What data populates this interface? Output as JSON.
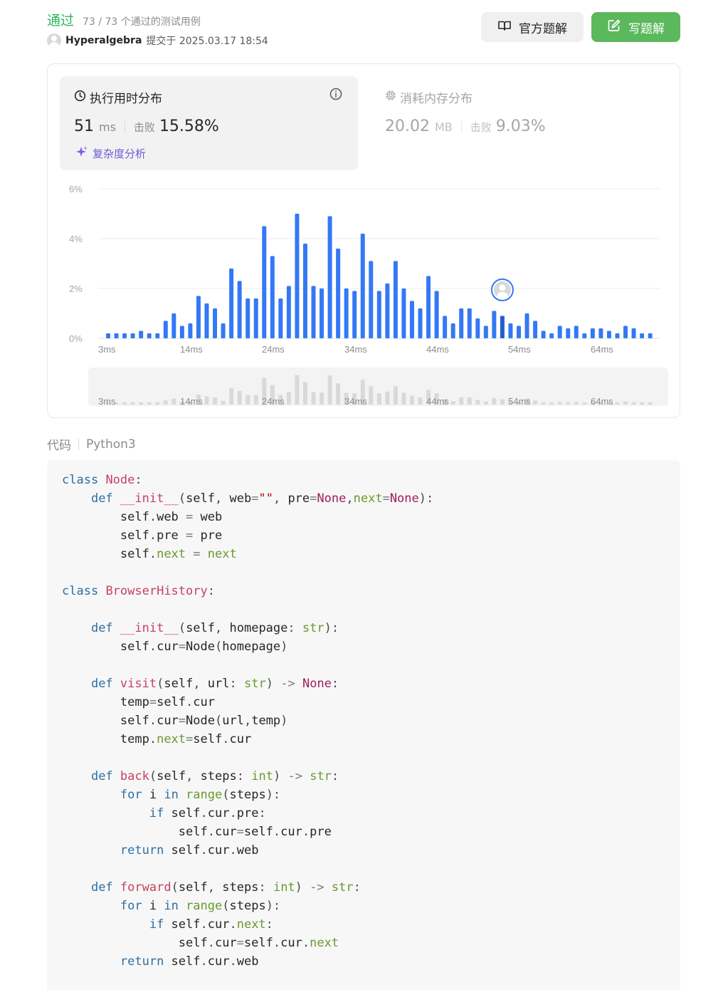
{
  "header": {
    "status": "通过",
    "testcases": "73 / 73 个通过的测试用例",
    "username": "Hyperalgebra",
    "submitted_text": "提交于 2025.03.17 18:54",
    "official_button": "官方题解",
    "write_button": "写题解"
  },
  "runtime": {
    "title": "执行用时分布",
    "value": "51",
    "unit": "ms",
    "beat_label": "击败",
    "beat_percent": "15.58%",
    "complexity_link": "复杂度分析"
  },
  "memory": {
    "title": "消耗内存分布",
    "value": "20.02",
    "unit": "MB",
    "beat_label": "击败",
    "beat_percent": "9.03%"
  },
  "chart_data": {
    "type": "bar",
    "x_tick_labels": [
      "3ms",
      "14ms",
      "24ms",
      "34ms",
      "44ms",
      "54ms",
      "64ms"
    ],
    "y_tick_labels": [
      "6%",
      "4%",
      "2%",
      "0%"
    ],
    "ylim": [
      0,
      6
    ],
    "values": [
      0.2,
      0.2,
      0.2,
      0.2,
      0.3,
      0.2,
      0.2,
      0.7,
      1.0,
      0.5,
      0.6,
      1.7,
      1.4,
      1.2,
      0.6,
      2.8,
      2.3,
      1.6,
      1.6,
      4.5,
      3.3,
      1.6,
      2.1,
      5.0,
      3.8,
      2.1,
      2.0,
      4.9,
      3.6,
      2.0,
      1.9,
      4.2,
      3.1,
      1.9,
      2.2,
      3.1,
      2.0,
      1.5,
      1.2,
      2.5,
      1.9,
      0.9,
      0.6,
      1.2,
      1.2,
      0.8,
      0.5,
      1.1,
      0.9,
      0.6,
      0.5,
      1.0,
      0.7,
      0.3,
      0.2,
      0.5,
      0.4,
      0.5,
      0.2,
      0.4,
      0.4,
      0.3,
      0.2,
      0.5,
      0.4,
      0.2,
      0.2
    ],
    "highlight_index": 48,
    "bar_color": "#3478f6",
    "highlight_color": "#1f5fd1",
    "grid": true
  },
  "code": {
    "label": "代码",
    "language": "Python3",
    "lines": [
      [
        [
          "kw",
          "class"
        ],
        [
          "t",
          " "
        ],
        [
          "cls",
          "Node"
        ],
        [
          "pun",
          ":"
        ]
      ],
      [
        [
          "t",
          "    "
        ],
        [
          "kw",
          "def"
        ],
        [
          "t",
          " "
        ],
        [
          "fn",
          "__init__"
        ],
        [
          "pun",
          "("
        ],
        [
          "t",
          "self"
        ],
        [
          "pun",
          ","
        ],
        [
          "t",
          " web"
        ],
        [
          "op",
          "="
        ],
        [
          "str",
          "\"\""
        ],
        [
          "pun",
          ","
        ],
        [
          "t",
          " pre"
        ],
        [
          "op",
          "="
        ],
        [
          "nn",
          "None"
        ],
        [
          "pun",
          ","
        ],
        [
          "bi",
          "next"
        ],
        [
          "op",
          "="
        ],
        [
          "nn",
          "None"
        ],
        [
          "pun",
          "):"
        ]
      ],
      [
        [
          "t",
          "        self"
        ],
        [
          "pun",
          "."
        ],
        [
          "t",
          "web "
        ],
        [
          "op",
          "="
        ],
        [
          "t",
          " web"
        ]
      ],
      [
        [
          "t",
          "        self"
        ],
        [
          "pun",
          "."
        ],
        [
          "t",
          "pre "
        ],
        [
          "op",
          "="
        ],
        [
          "t",
          " pre"
        ]
      ],
      [
        [
          "t",
          "        self"
        ],
        [
          "pun",
          "."
        ],
        [
          "bi",
          "next"
        ],
        [
          "t",
          " "
        ],
        [
          "op",
          "="
        ],
        [
          "t",
          " "
        ],
        [
          "bi",
          "next"
        ]
      ],
      [],
      [
        [
          "kw",
          "class"
        ],
        [
          "t",
          " "
        ],
        [
          "cls",
          "BrowserHistory"
        ],
        [
          "pun",
          ":"
        ]
      ],
      [],
      [
        [
          "t",
          "    "
        ],
        [
          "kw",
          "def"
        ],
        [
          "t",
          " "
        ],
        [
          "fn",
          "__init__"
        ],
        [
          "pun",
          "("
        ],
        [
          "t",
          "self"
        ],
        [
          "pun",
          ","
        ],
        [
          "t",
          " homepage"
        ],
        [
          "pun",
          ":"
        ],
        [
          "t",
          " "
        ],
        [
          "bi",
          "str"
        ],
        [
          "pun",
          "):"
        ]
      ],
      [
        [
          "t",
          "        self"
        ],
        [
          "pun",
          "."
        ],
        [
          "t",
          "cur"
        ],
        [
          "op",
          "="
        ],
        [
          "t",
          "Node"
        ],
        [
          "pun",
          "("
        ],
        [
          "t",
          "homepage"
        ],
        [
          "pun",
          ")"
        ]
      ],
      [],
      [
        [
          "t",
          "    "
        ],
        [
          "kw",
          "def"
        ],
        [
          "t",
          " "
        ],
        [
          "fn",
          "visit"
        ],
        [
          "pun",
          "("
        ],
        [
          "t",
          "self"
        ],
        [
          "pun",
          ","
        ],
        [
          "t",
          " url"
        ],
        [
          "pun",
          ":"
        ],
        [
          "t",
          " "
        ],
        [
          "bi",
          "str"
        ],
        [
          "pun",
          ")"
        ],
        [
          "t",
          " "
        ],
        [
          "op",
          "->"
        ],
        [
          "t",
          " "
        ],
        [
          "nn",
          "None"
        ],
        [
          "pun",
          ":"
        ]
      ],
      [
        [
          "t",
          "        temp"
        ],
        [
          "op",
          "="
        ],
        [
          "t",
          "self"
        ],
        [
          "pun",
          "."
        ],
        [
          "t",
          "cur"
        ]
      ],
      [
        [
          "t",
          "        self"
        ],
        [
          "pun",
          "."
        ],
        [
          "t",
          "cur"
        ],
        [
          "op",
          "="
        ],
        [
          "t",
          "Node"
        ],
        [
          "pun",
          "("
        ],
        [
          "t",
          "url"
        ],
        [
          "pun",
          ","
        ],
        [
          "t",
          "temp"
        ],
        [
          "pun",
          ")"
        ]
      ],
      [
        [
          "t",
          "        temp"
        ],
        [
          "pun",
          "."
        ],
        [
          "bi",
          "next"
        ],
        [
          "op",
          "="
        ],
        [
          "t",
          "self"
        ],
        [
          "pun",
          "."
        ],
        [
          "t",
          "cur"
        ]
      ],
      [],
      [
        [
          "t",
          "    "
        ],
        [
          "kw",
          "def"
        ],
        [
          "t",
          " "
        ],
        [
          "fn",
          "back"
        ],
        [
          "pun",
          "("
        ],
        [
          "t",
          "self"
        ],
        [
          "pun",
          ","
        ],
        [
          "t",
          " steps"
        ],
        [
          "pun",
          ":"
        ],
        [
          "t",
          " "
        ],
        [
          "bi",
          "int"
        ],
        [
          "pun",
          ")"
        ],
        [
          "t",
          " "
        ],
        [
          "op",
          "->"
        ],
        [
          "t",
          " "
        ],
        [
          "bi",
          "str"
        ],
        [
          "pun",
          ":"
        ]
      ],
      [
        [
          "t",
          "        "
        ],
        [
          "kw",
          "for"
        ],
        [
          "t",
          " i "
        ],
        [
          "kw",
          "in"
        ],
        [
          "t",
          " "
        ],
        [
          "bi",
          "range"
        ],
        [
          "pun",
          "("
        ],
        [
          "t",
          "steps"
        ],
        [
          "pun",
          "):"
        ]
      ],
      [
        [
          "t",
          "            "
        ],
        [
          "kw",
          "if"
        ],
        [
          "t",
          " self"
        ],
        [
          "pun",
          "."
        ],
        [
          "t",
          "cur"
        ],
        [
          "pun",
          "."
        ],
        [
          "t",
          "pre"
        ],
        [
          "pun",
          ":"
        ]
      ],
      [
        [
          "t",
          "                self"
        ],
        [
          "pun",
          "."
        ],
        [
          "t",
          "cur"
        ],
        [
          "op",
          "="
        ],
        [
          "t",
          "self"
        ],
        [
          "pun",
          "."
        ],
        [
          "t",
          "cur"
        ],
        [
          "pun",
          "."
        ],
        [
          "t",
          "pre"
        ]
      ],
      [
        [
          "t",
          "        "
        ],
        [
          "kw",
          "return"
        ],
        [
          "t",
          " self"
        ],
        [
          "pun",
          "."
        ],
        [
          "t",
          "cur"
        ],
        [
          "pun",
          "."
        ],
        [
          "t",
          "web"
        ]
      ],
      [],
      [
        [
          "t",
          "    "
        ],
        [
          "kw",
          "def"
        ],
        [
          "t",
          " "
        ],
        [
          "fn",
          "forward"
        ],
        [
          "pun",
          "("
        ],
        [
          "t",
          "self"
        ],
        [
          "pun",
          ","
        ],
        [
          "t",
          " steps"
        ],
        [
          "pun",
          ":"
        ],
        [
          "t",
          " "
        ],
        [
          "bi",
          "int"
        ],
        [
          "pun",
          ")"
        ],
        [
          "t",
          " "
        ],
        [
          "op",
          "->"
        ],
        [
          "t",
          " "
        ],
        [
          "bi",
          "str"
        ],
        [
          "pun",
          ":"
        ]
      ],
      [
        [
          "t",
          "        "
        ],
        [
          "kw",
          "for"
        ],
        [
          "t",
          " i "
        ],
        [
          "kw",
          "in"
        ],
        [
          "t",
          " "
        ],
        [
          "bi",
          "range"
        ],
        [
          "pun",
          "("
        ],
        [
          "t",
          "steps"
        ],
        [
          "pun",
          "):"
        ]
      ],
      [
        [
          "t",
          "            "
        ],
        [
          "kw",
          "if"
        ],
        [
          "t",
          " self"
        ],
        [
          "pun",
          "."
        ],
        [
          "t",
          "cur"
        ],
        [
          "pun",
          "."
        ],
        [
          "bi",
          "next"
        ],
        [
          "pun",
          ":"
        ]
      ],
      [
        [
          "t",
          "                self"
        ],
        [
          "pun",
          "."
        ],
        [
          "t",
          "cur"
        ],
        [
          "op",
          "="
        ],
        [
          "t",
          "self"
        ],
        [
          "pun",
          "."
        ],
        [
          "t",
          "cur"
        ],
        [
          "pun",
          "."
        ],
        [
          "bi",
          "next"
        ]
      ],
      [
        [
          "t",
          "        "
        ],
        [
          "kw",
          "return"
        ],
        [
          "t",
          " self"
        ],
        [
          "pun",
          "."
        ],
        [
          "t",
          "cur"
        ],
        [
          "pun",
          "."
        ],
        [
          "t",
          "web"
        ]
      ]
    ]
  }
}
